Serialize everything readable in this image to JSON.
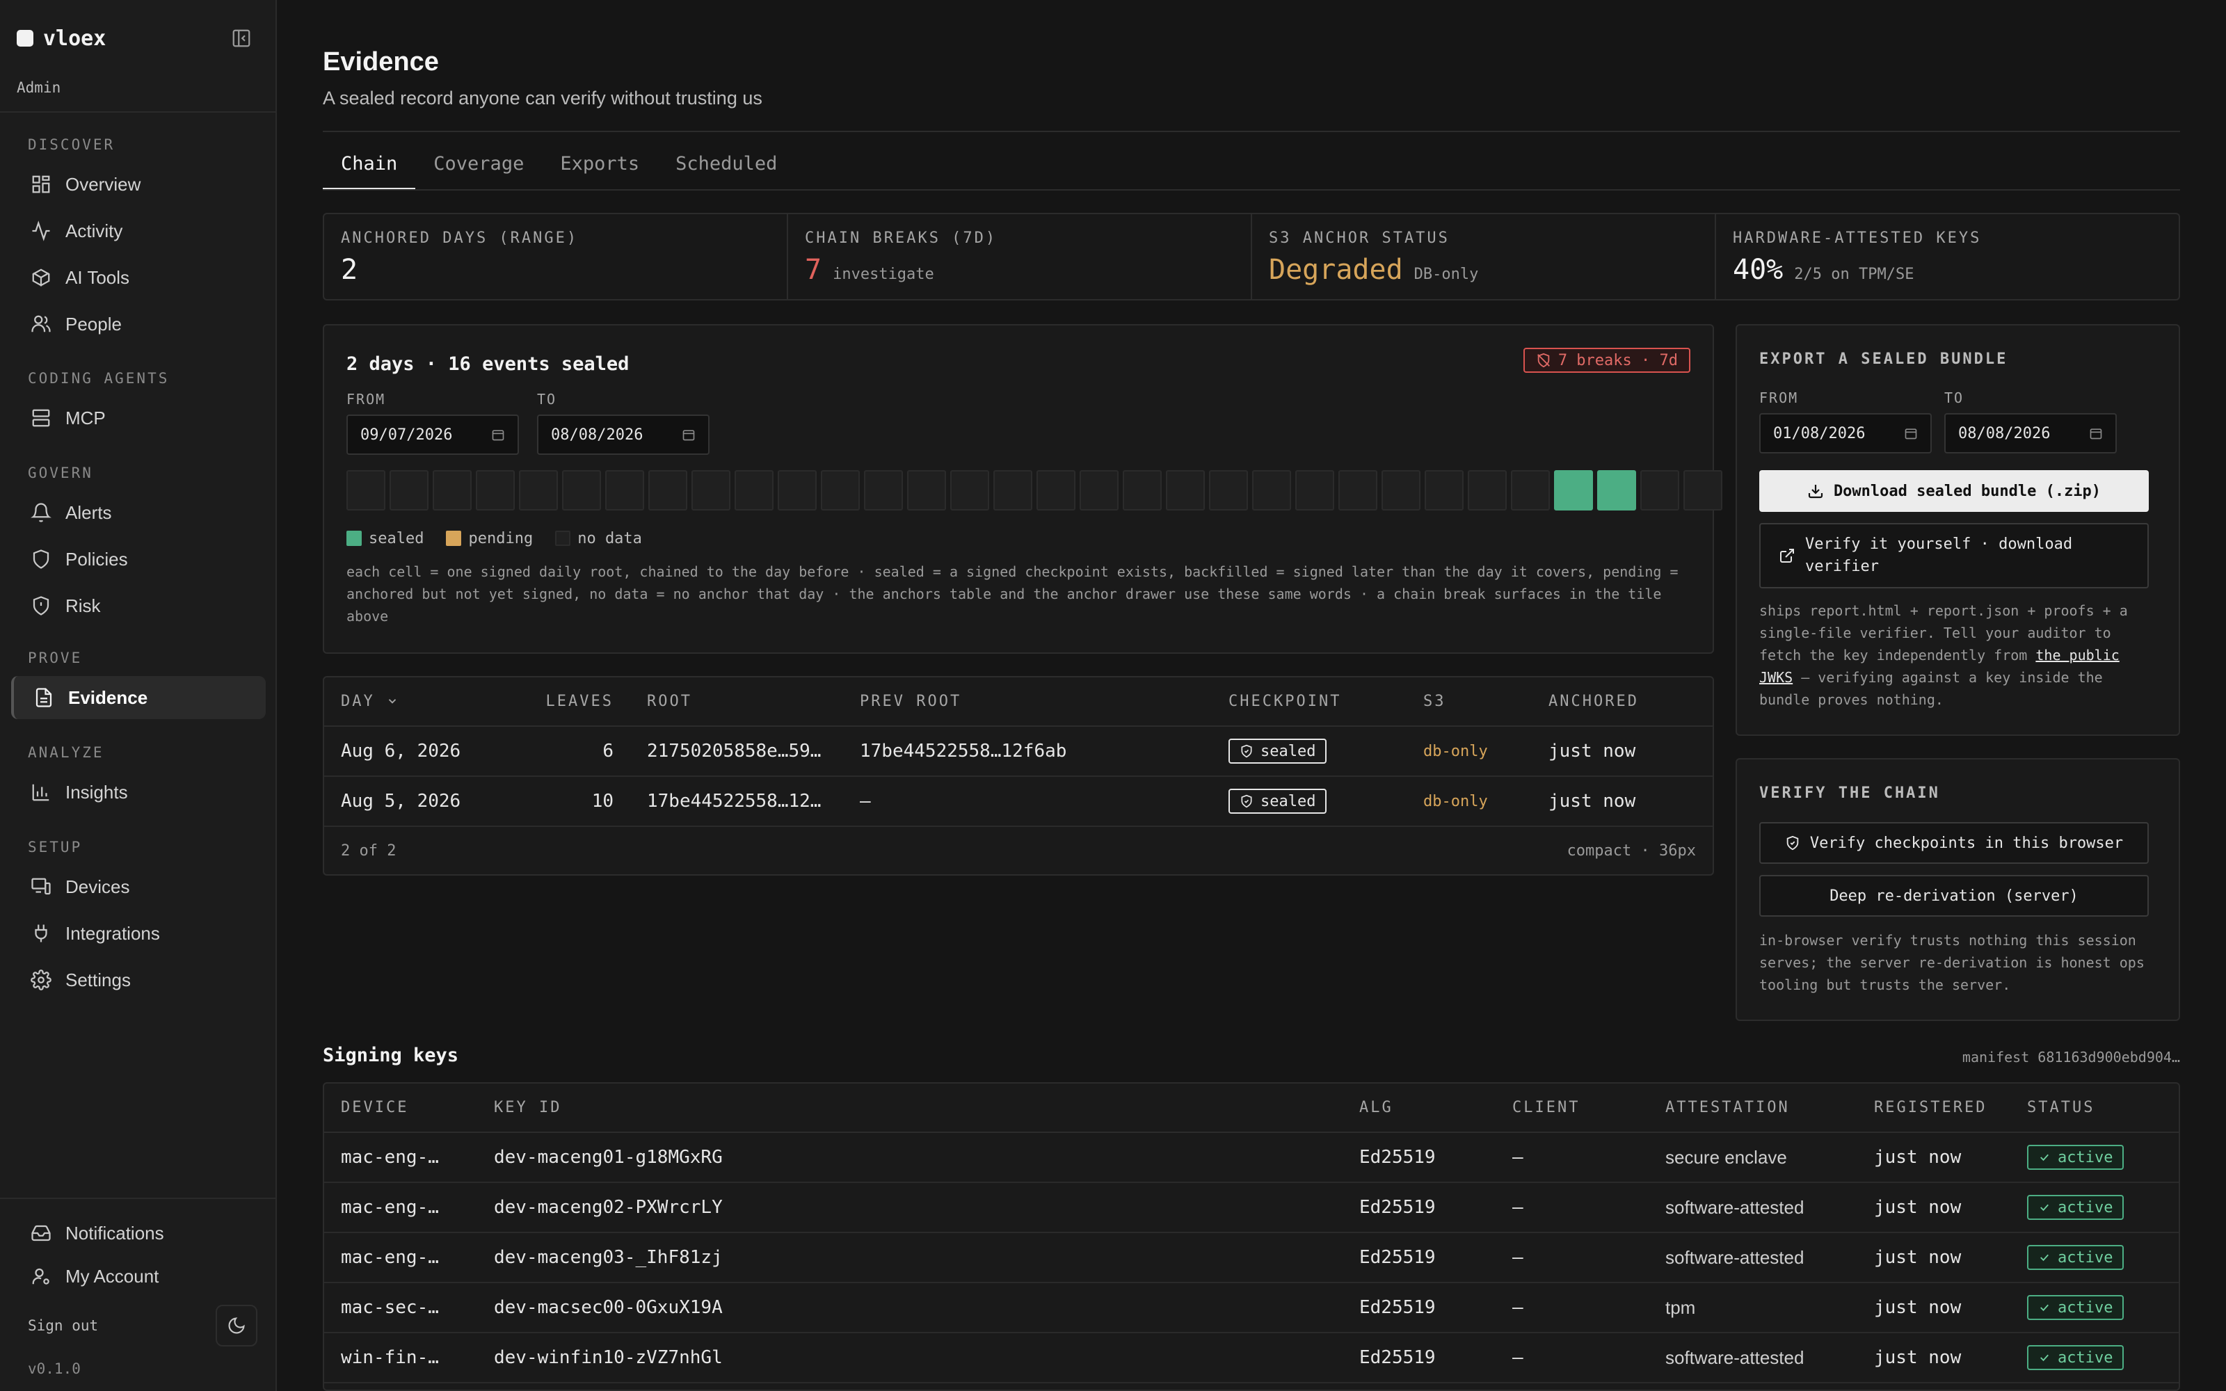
{
  "app": {
    "name": "vloex",
    "role": "Admin",
    "version": "v0.1.0",
    "sign_out": "Sign out"
  },
  "nav": {
    "sections": [
      {
        "title": "DISCOVER",
        "items": [
          "Overview",
          "Activity",
          "AI Tools",
          "People"
        ]
      },
      {
        "title": "CODING AGENTS",
        "items": [
          "MCP"
        ]
      },
      {
        "title": "GOVERN",
        "items": [
          "Alerts",
          "Policies",
          "Risk"
        ]
      },
      {
        "title": "PROVE",
        "items": [
          "Evidence"
        ]
      },
      {
        "title": "ANALYZE",
        "items": [
          "Insights"
        ]
      },
      {
        "title": "SETUP",
        "items": [
          "Devices",
          "Integrations",
          "Settings"
        ]
      }
    ],
    "active": "Evidence",
    "footer_items": [
      "Notifications",
      "My Account"
    ]
  },
  "page": {
    "title": "Evidence",
    "subtitle": "A sealed record anyone can verify without trusting us"
  },
  "tabs": [
    "Chain",
    "Coverage",
    "Exports",
    "Scheduled"
  ],
  "active_tab": "Chain",
  "stats": [
    {
      "label": "ANCHORED DAYS (RANGE)",
      "value": "2",
      "note": "",
      "color": "#f2f2f2"
    },
    {
      "label": "CHAIN BREAKS (7D)",
      "value": "7",
      "note": "investigate",
      "color": "#e0625c"
    },
    {
      "label": "S3 ANCHOR STATUS",
      "value": "Degraded",
      "note": "DB-only",
      "color": "#d7a55a"
    },
    {
      "label": "HARDWARE-ATTESTED KEYS",
      "value": "40%",
      "note": "2/5 on TPM/SE",
      "color": "#f2f2f2"
    }
  ],
  "chain": {
    "summary": "2 days · 16 events sealed",
    "breaks_badge": "7 breaks · 7d",
    "from_label": "FROM",
    "to_label": "TO",
    "from": "09/07/2026",
    "to": "08/08/2026",
    "cells": [
      "none",
      "none",
      "none",
      "none",
      "none",
      "none",
      "none",
      "none",
      "none",
      "none",
      "none",
      "none",
      "none",
      "none",
      "none",
      "none",
      "none",
      "none",
      "none",
      "none",
      "none",
      "none",
      "none",
      "none",
      "none",
      "none",
      "none",
      "none",
      "sealed",
      "sealed",
      "none",
      "none"
    ],
    "legend": {
      "sealed": "sealed",
      "pending": "pending",
      "nodata": "no data"
    },
    "legend_colors": {
      "sealed": "#4cae84",
      "pending": "#d7a55a",
      "nodata": "#202020"
    },
    "help": "each cell = one signed daily root, chained to the day before · sealed = a signed checkpoint exists, backfilled = signed later than the day it covers, pending = anchored but not yet signed, no data = no anchor that day · the anchors table and the anchor drawer use these same words · a chain break surfaces in the tile above"
  },
  "days_table": {
    "headers": [
      "DAY",
      "LEAVES",
      "ROOT",
      "PREV ROOT",
      "CHECKPOINT",
      "S3",
      "ANCHORED"
    ],
    "rows": [
      {
        "day": "Aug 6, 2026",
        "leaves": "6",
        "root": "21750205858e…59…",
        "prev_root": "17be44522558…12f6ab",
        "checkpoint": "sealed",
        "s3": "db-only",
        "anchored": "just now"
      },
      {
        "day": "Aug 5, 2026",
        "leaves": "10",
        "root": "17be44522558…12…",
        "prev_root": "—",
        "checkpoint": "sealed",
        "s3": "db-only",
        "anchored": "just now"
      }
    ],
    "count": "2 of 2",
    "density": "compact · 36px"
  },
  "export": {
    "title": "EXPORT A SEALED BUNDLE",
    "from_label": "FROM",
    "to_label": "TO",
    "from": "01/08/2026",
    "to": "08/08/2026",
    "download": "Download sealed bundle (.zip)",
    "verify_line1": "Verify it yourself · download",
    "verify_line2": "verifier",
    "help_a": "ships report.html + report.json + proofs + a single-file verifier. Tell your auditor to fetch the key independently from ",
    "help_link": "the public JWKS",
    "help_b": " — verifying against a key inside the bundle proves nothing."
  },
  "verify": {
    "title": "VERIFY THE CHAIN",
    "browser_btn": "Verify checkpoints in this browser",
    "server_btn": "Deep re-derivation (server)",
    "help": "in-browser verify trusts nothing this session serves; the server re-derivation is honest ops tooling but trusts the server."
  },
  "keys": {
    "title": "Signing keys",
    "manifest": "manifest 681163d900ebd904…",
    "headers": [
      "DEVICE",
      "KEY ID",
      "ALG",
      "CLIENT",
      "ATTESTATION",
      "REGISTERED",
      "STATUS"
    ],
    "rows": [
      {
        "device": "mac-eng-…",
        "key_id": "dev-maceng01-g18MGxRG",
        "alg": "Ed25519",
        "client": "—",
        "attestation": "secure enclave",
        "registered": "just now",
        "status": "active"
      },
      {
        "device": "mac-eng-…",
        "key_id": "dev-maceng02-PXWrcrLY",
        "alg": "Ed25519",
        "client": "—",
        "attestation": "software-attested",
        "registered": "just now",
        "status": "active"
      },
      {
        "device": "mac-eng-…",
        "key_id": "dev-maceng03-_IhF81zj",
        "alg": "Ed25519",
        "client": "—",
        "attestation": "software-attested",
        "registered": "just now",
        "status": "active"
      },
      {
        "device": "mac-sec-…",
        "key_id": "dev-macsec00-0GxuX19A",
        "alg": "Ed25519",
        "client": "—",
        "attestation": "tpm",
        "registered": "just now",
        "status": "active"
      },
      {
        "device": "win-fin-…",
        "key_id": "dev-winfin10-zVZ7nhGl",
        "alg": "Ed25519",
        "client": "—",
        "attestation": "software-attested",
        "registered": "just now",
        "status": "active"
      }
    ]
  }
}
